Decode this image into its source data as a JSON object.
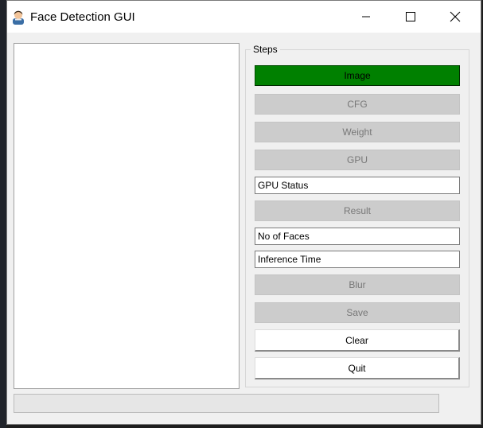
{
  "window": {
    "title": "Face Detection GUI",
    "icon": "person-face-icon",
    "controls": [
      "minimize-icon",
      "maximize-icon",
      "close-icon"
    ]
  },
  "steps": {
    "label": "Steps",
    "image_button": "Image",
    "cfg_button": "CFG",
    "weight_button": "Weight",
    "gpu_button": "GPU",
    "gpu_status": "GPU Status",
    "result_button": "Result",
    "faces_field": "No of Faces",
    "inference_field": "Inference Time",
    "blur_button": "Blur",
    "save_button": "Save",
    "clear_button": "Clear",
    "quit_button": "Quit"
  },
  "progress": {
    "value": 0
  },
  "colors": {
    "active_button": "#008000",
    "disabled_button": "#cccccc",
    "disabled_text": "#777777",
    "window_bg": "#f0f0f0"
  }
}
